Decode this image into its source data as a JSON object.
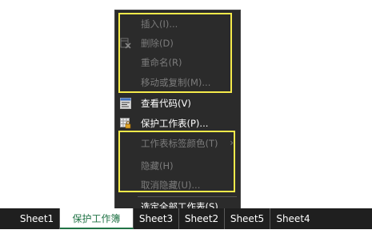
{
  "context_menu": {
    "items": [
      {
        "label": "插入(I)...",
        "icon": "",
        "enabled": false
      },
      {
        "label": "删除(D)",
        "icon": "delete-sheet-icon",
        "enabled": false
      },
      {
        "label": "重命名(R)",
        "icon": "",
        "enabled": false
      },
      {
        "label": "移动或复制(M)...",
        "icon": "",
        "enabled": false
      },
      {
        "label": "查看代码(V)",
        "icon": "view-code-icon",
        "enabled": true
      },
      {
        "label": "保护工作表(P)...",
        "icon": "protect-sheet-icon",
        "enabled": true
      },
      {
        "label": "工作表标签颜色(T)",
        "icon": "",
        "enabled": false,
        "has_submenu": true,
        "submenu_arrow": "›"
      },
      {
        "label": "隐藏(H)",
        "icon": "",
        "enabled": false
      },
      {
        "label": "取消隐藏(U)...",
        "icon": "",
        "enabled": false
      },
      {
        "label": "选定全部工作表(S)",
        "icon": "",
        "enabled": true
      }
    ]
  },
  "sheet_tabs": [
    {
      "label": "Sheet1",
      "active": false
    },
    {
      "label": "保护工作簿",
      "active": true
    },
    {
      "label": "Sheet3",
      "active": false
    },
    {
      "label": "Sheet2",
      "active": false
    },
    {
      "label": "Sheet5",
      "active": false
    },
    {
      "label": "Sheet4",
      "active": false
    }
  ],
  "colors": {
    "menu_background": "#2b2b2b",
    "disabled_text": "#7b7b7b",
    "enabled_text": "#ffffff",
    "highlight_box": "#f5ea4a",
    "active_tab_text": "#217346"
  }
}
